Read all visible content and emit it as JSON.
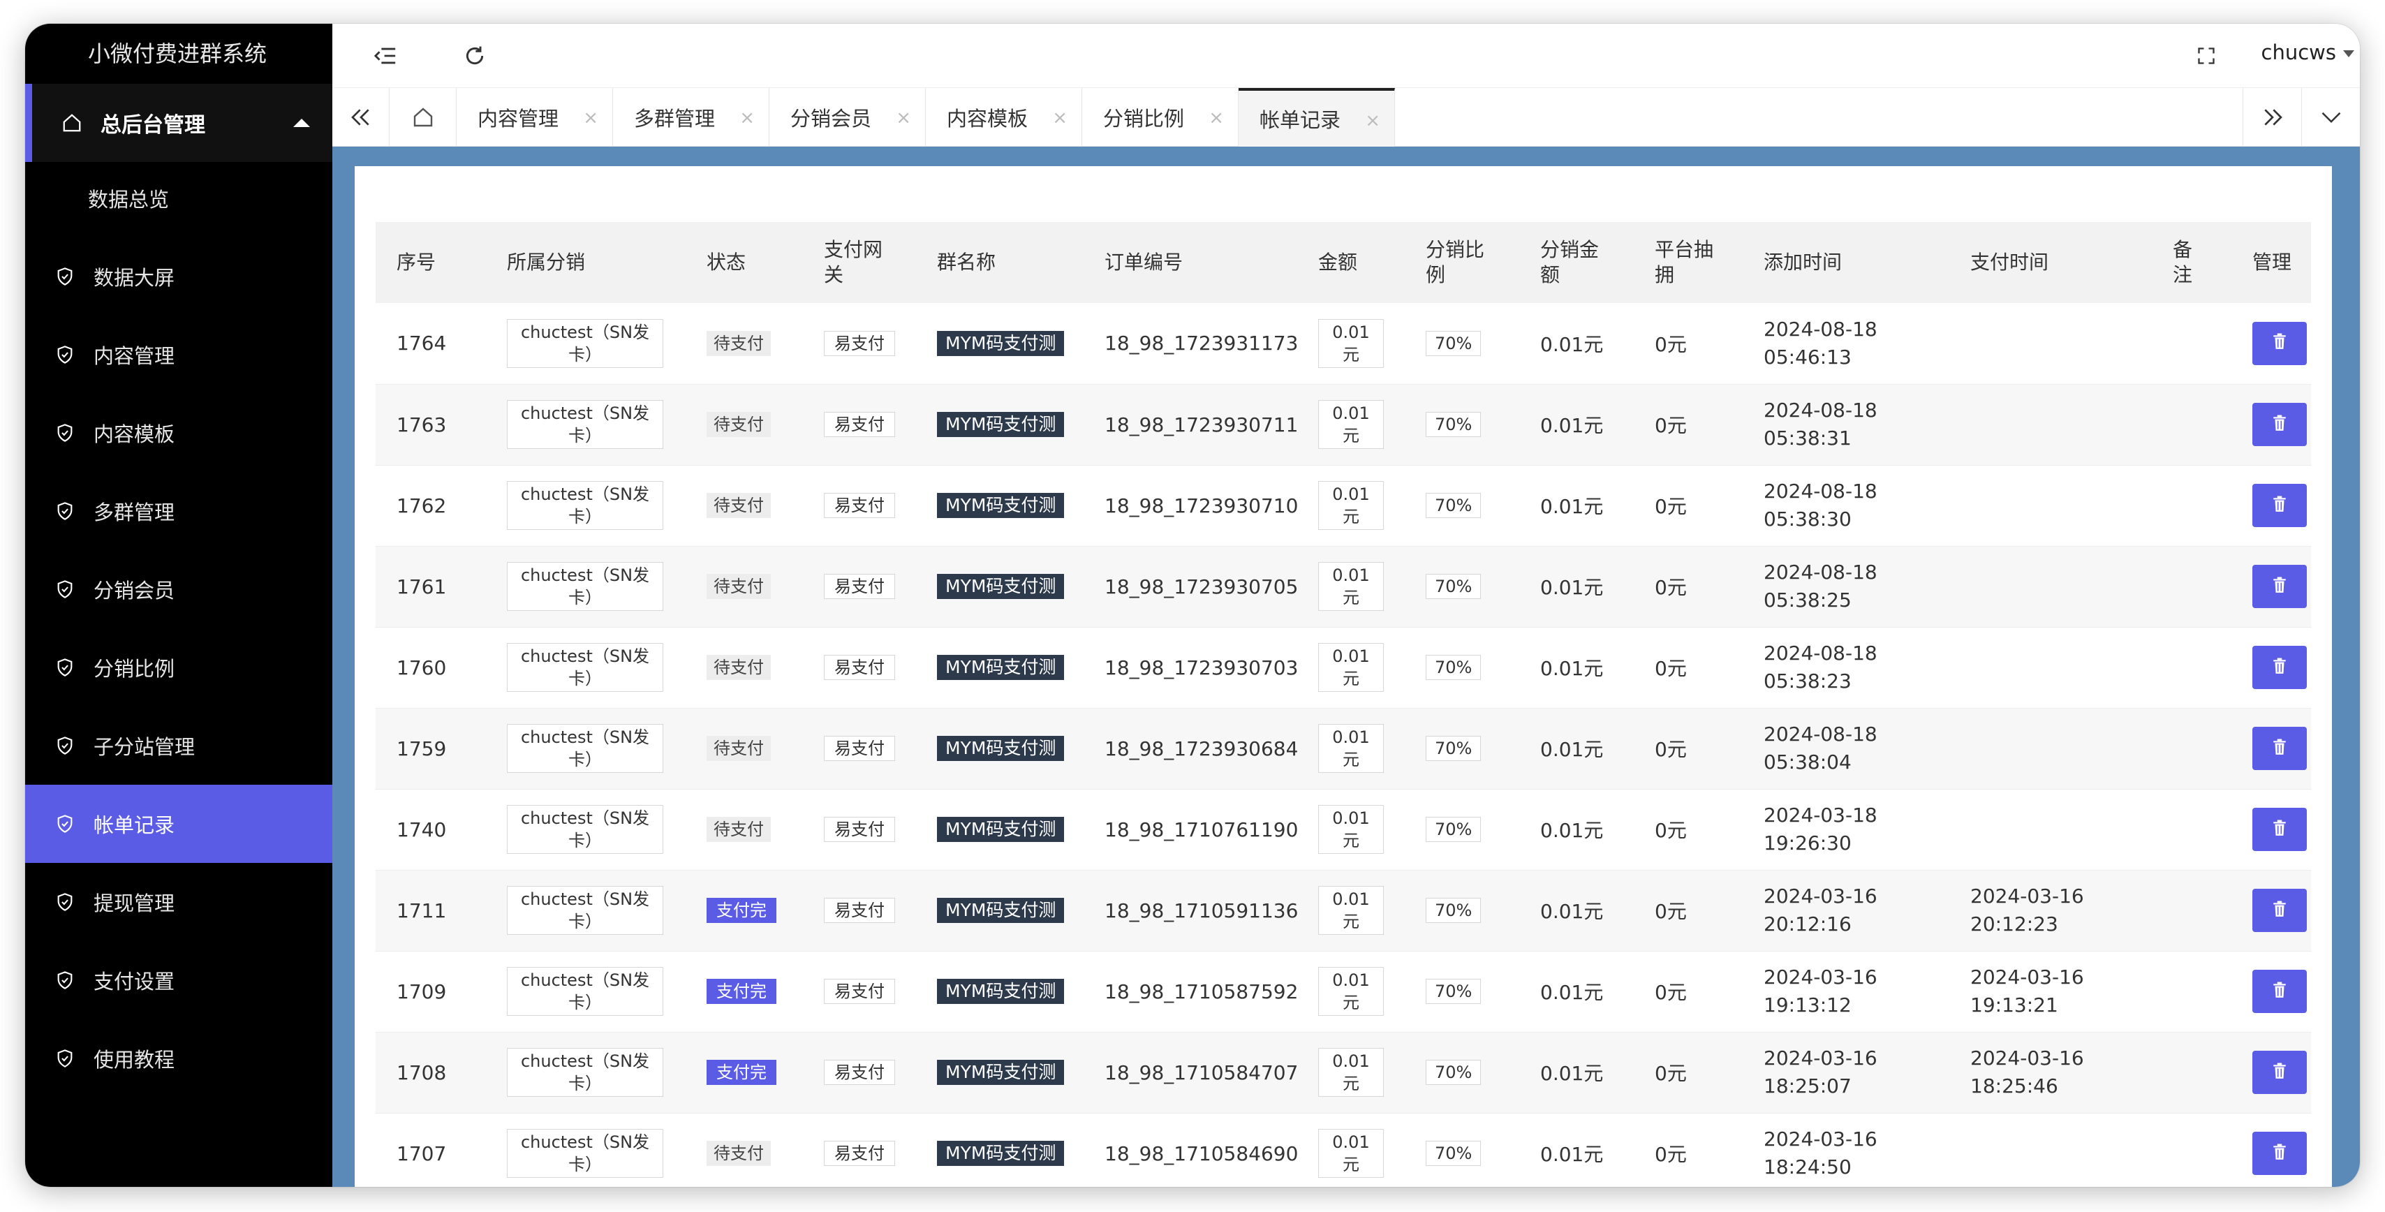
{
  "app": {
    "title": "小微付费进群系统"
  },
  "sidebar": {
    "group": {
      "label": "总后台管理"
    },
    "sub_items": [
      {
        "label": "数据总览"
      }
    ],
    "items": [
      {
        "label": "数据大屏"
      },
      {
        "label": "内容管理"
      },
      {
        "label": "内容模板"
      },
      {
        "label": "多群管理"
      },
      {
        "label": "分销会员"
      },
      {
        "label": "分销比例"
      },
      {
        "label": "子分站管理"
      },
      {
        "label": "帐单记录",
        "active": true
      },
      {
        "label": "提现管理"
      },
      {
        "label": "支付设置"
      },
      {
        "label": "使用教程"
      }
    ]
  },
  "header": {
    "user": "chucws"
  },
  "tabs": [
    {
      "label": "内容管理"
    },
    {
      "label": "多群管理"
    },
    {
      "label": "分销会员"
    },
    {
      "label": "内容模板"
    },
    {
      "label": "分销比例"
    },
    {
      "label": "帐单记录",
      "active": true
    }
  ],
  "tab_close": "×",
  "table": {
    "headers": {
      "id": "序号",
      "dist": "所属分销",
      "status": "状态",
      "gw1": "支付网",
      "gw2": "关",
      "group": "群名称",
      "order": "订单编号",
      "amount": "金额",
      "ratio1": "分销比",
      "ratio2": "例",
      "damt1": "分销金",
      "damt2": "额",
      "plat1": "平台抽",
      "plat2": "拥",
      "added": "添加时间",
      "paid": "支付时间",
      "note1": "备",
      "note2": "注",
      "manage": "管理"
    },
    "rows": [
      {
        "id": "1764",
        "dist1": "chuctest（SN发",
        "dist2": "卡）",
        "status": "待支付",
        "paid_status": false,
        "gateway": "易支付",
        "group": "MYM码支付测",
        "order": "18_98_1723931173",
        "amt1": "0.01",
        "amt2": "元",
        "ratio": "70%",
        "dist_amount": "0.01元",
        "platform": "0元",
        "added1": "2024-08-18",
        "added2": "05:46:13",
        "paid1": "",
        "paid2": ""
      },
      {
        "id": "1763",
        "dist1": "chuctest（SN发",
        "dist2": "卡）",
        "status": "待支付",
        "paid_status": false,
        "gateway": "易支付",
        "group": "MYM码支付测",
        "order": "18_98_1723930711",
        "amt1": "0.01",
        "amt2": "元",
        "ratio": "70%",
        "dist_amount": "0.01元",
        "platform": "0元",
        "added1": "2024-08-18",
        "added2": "05:38:31",
        "paid1": "",
        "paid2": ""
      },
      {
        "id": "1762",
        "dist1": "chuctest（SN发",
        "dist2": "卡）",
        "status": "待支付",
        "paid_status": false,
        "gateway": "易支付",
        "group": "MYM码支付测",
        "order": "18_98_1723930710",
        "amt1": "0.01",
        "amt2": "元",
        "ratio": "70%",
        "dist_amount": "0.01元",
        "platform": "0元",
        "added1": "2024-08-18",
        "added2": "05:38:30",
        "paid1": "",
        "paid2": ""
      },
      {
        "id": "1761",
        "dist1": "chuctest（SN发",
        "dist2": "卡）",
        "status": "待支付",
        "paid_status": false,
        "gateway": "易支付",
        "group": "MYM码支付测",
        "order": "18_98_1723930705",
        "amt1": "0.01",
        "amt2": "元",
        "ratio": "70%",
        "dist_amount": "0.01元",
        "platform": "0元",
        "added1": "2024-08-18",
        "added2": "05:38:25",
        "paid1": "",
        "paid2": ""
      },
      {
        "id": "1760",
        "dist1": "chuctest（SN发",
        "dist2": "卡）",
        "status": "待支付",
        "paid_status": false,
        "gateway": "易支付",
        "group": "MYM码支付测",
        "order": "18_98_1723930703",
        "amt1": "0.01",
        "amt2": "元",
        "ratio": "70%",
        "dist_amount": "0.01元",
        "platform": "0元",
        "added1": "2024-08-18",
        "added2": "05:38:23",
        "paid1": "",
        "paid2": ""
      },
      {
        "id": "1759",
        "dist1": "chuctest（SN发",
        "dist2": "卡）",
        "status": "待支付",
        "paid_status": false,
        "gateway": "易支付",
        "group": "MYM码支付测",
        "order": "18_98_1723930684",
        "amt1": "0.01",
        "amt2": "元",
        "ratio": "70%",
        "dist_amount": "0.01元",
        "platform": "0元",
        "added1": "2024-08-18",
        "added2": "05:38:04",
        "paid1": "",
        "paid2": ""
      },
      {
        "id": "1740",
        "dist1": "chuctest（SN发",
        "dist2": "卡）",
        "status": "待支付",
        "paid_status": false,
        "gateway": "易支付",
        "group": "MYM码支付测",
        "order": "18_98_1710761190",
        "amt1": "0.01",
        "amt2": "元",
        "ratio": "70%",
        "dist_amount": "0.01元",
        "platform": "0元",
        "added1": "2024-03-18",
        "added2": "19:26:30",
        "paid1": "",
        "paid2": ""
      },
      {
        "id": "1711",
        "dist1": "chuctest（SN发",
        "dist2": "卡）",
        "status": "支付完",
        "paid_status": true,
        "gateway": "易支付",
        "group": "MYM码支付测",
        "order": "18_98_1710591136",
        "amt1": "0.01",
        "amt2": "元",
        "ratio": "70%",
        "dist_amount": "0.01元",
        "platform": "0元",
        "added1": "2024-03-16",
        "added2": "20:12:16",
        "paid1": "2024-03-16",
        "paid2": "20:12:23"
      },
      {
        "id": "1709",
        "dist1": "chuctest（SN发",
        "dist2": "卡）",
        "status": "支付完",
        "paid_status": true,
        "gateway": "易支付",
        "group": "MYM码支付测",
        "order": "18_98_1710587592",
        "amt1": "0.01",
        "amt2": "元",
        "ratio": "70%",
        "dist_amount": "0.01元",
        "platform": "0元",
        "added1": "2024-03-16",
        "added2": "19:13:12",
        "paid1": "2024-03-16",
        "paid2": "19:13:21"
      },
      {
        "id": "1708",
        "dist1": "chuctest（SN发",
        "dist2": "卡）",
        "status": "支付完",
        "paid_status": true,
        "gateway": "易支付",
        "group": "MYM码支付测",
        "order": "18_98_1710584707",
        "amt1": "0.01",
        "amt2": "元",
        "ratio": "70%",
        "dist_amount": "0.01元",
        "platform": "0元",
        "added1": "2024-03-16",
        "added2": "18:25:07",
        "paid1": "2024-03-16",
        "paid2": "18:25:46"
      },
      {
        "id": "1707",
        "dist1": "chuctest（SN发",
        "dist2": "卡）",
        "status": "待支付",
        "paid_status": false,
        "gateway": "易支付",
        "group": "MYM码支付测",
        "order": "18_98_1710584690",
        "amt1": "0.01",
        "amt2": "元",
        "ratio": "70%",
        "dist_amount": "0.01元",
        "platform": "0元",
        "added1": "2024-03-16",
        "added2": "18:24:50",
        "paid1": "",
        "paid2": ""
      }
    ]
  }
}
